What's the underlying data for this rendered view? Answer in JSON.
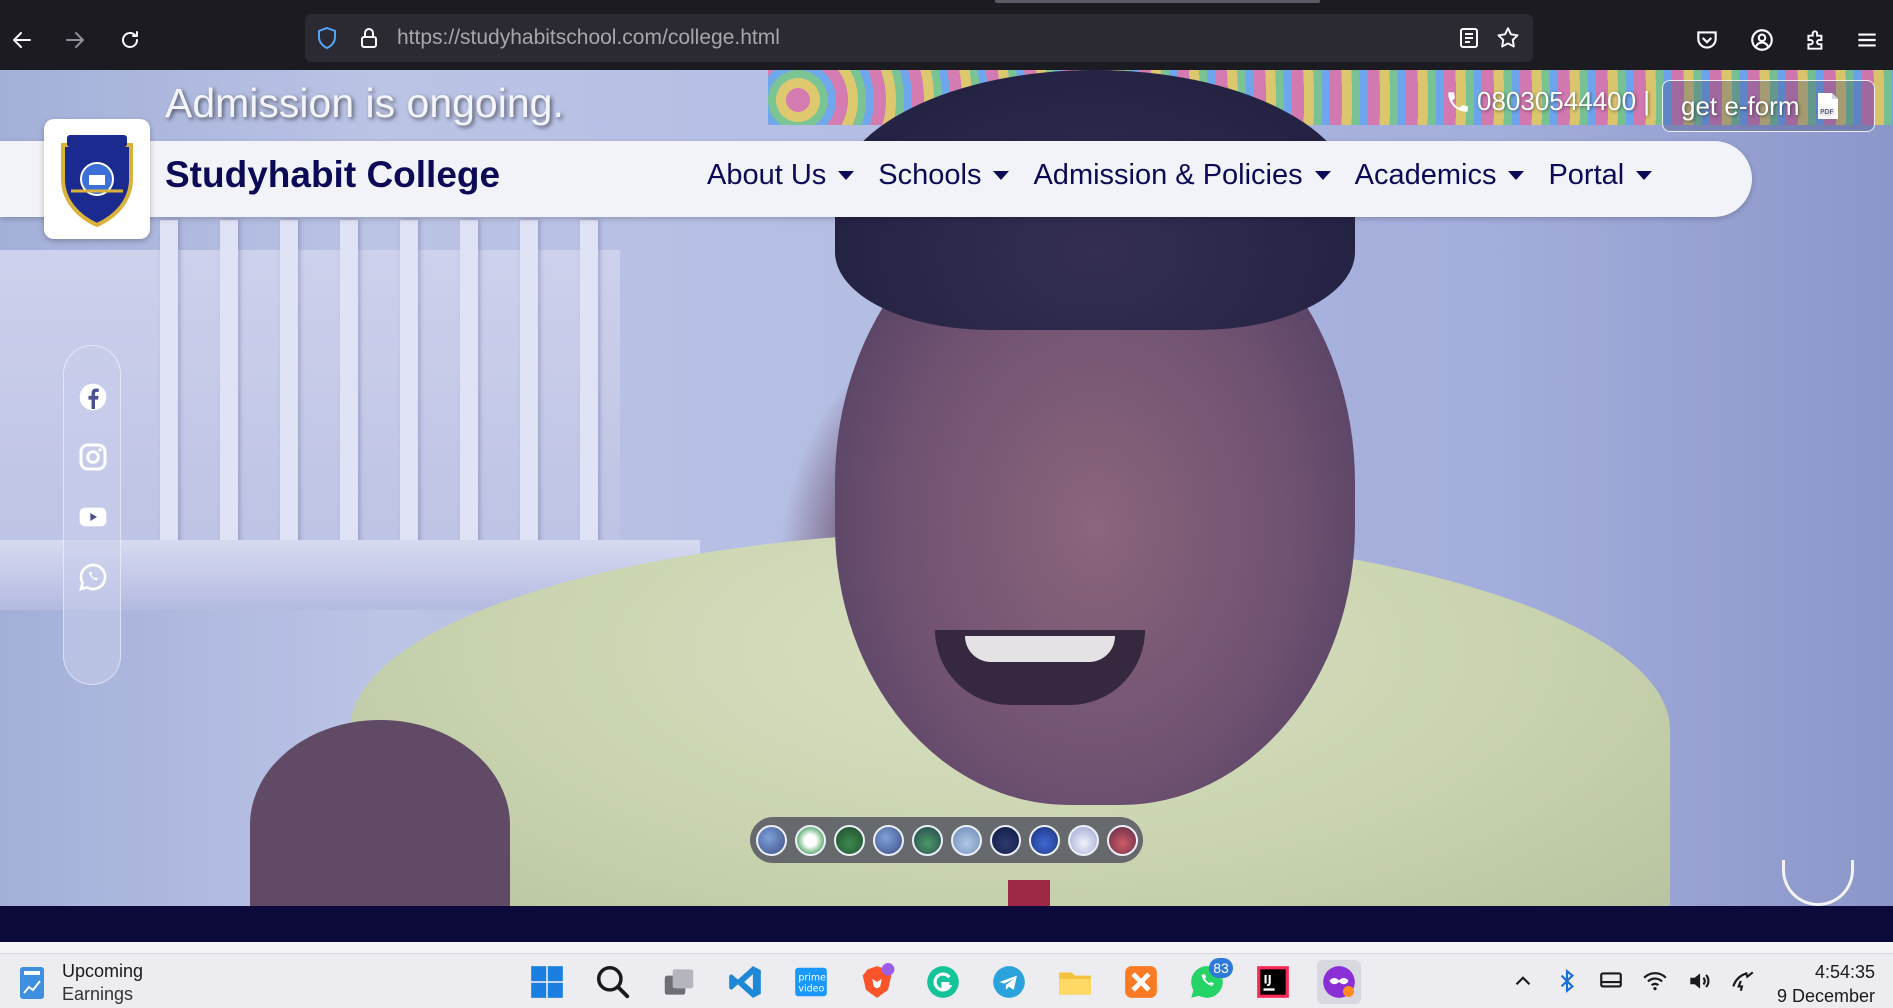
{
  "browser": {
    "url_host": "https://studyhabitschool.com",
    "url_path": "/college.html"
  },
  "topstrip": {
    "admission_text": "Admission is ongoing.",
    "phone": "08030544400 |",
    "eform_label": "get e-form"
  },
  "navbar": {
    "brand": "Studyhabit College",
    "items": [
      {
        "label": "About Us"
      },
      {
        "label": "Schools"
      },
      {
        "label": "Admission & Policies"
      },
      {
        "label": "Academics"
      },
      {
        "label": "Portal"
      }
    ]
  },
  "social": [
    "facebook-icon",
    "instagram-icon",
    "youtube-icon",
    "whatsapp-icon"
  ],
  "slider": {
    "thumbnail_count": 10
  },
  "taskbar": {
    "weather_title": "Upcoming",
    "weather_sub": "Earnings",
    "whatsapp_badge": "83",
    "time": "4:54:35",
    "date": "9 December"
  },
  "colors": {
    "brand_navy": "#0c0a57",
    "page_band": "#0b0a3b",
    "browser_bg": "#1c1b22"
  }
}
